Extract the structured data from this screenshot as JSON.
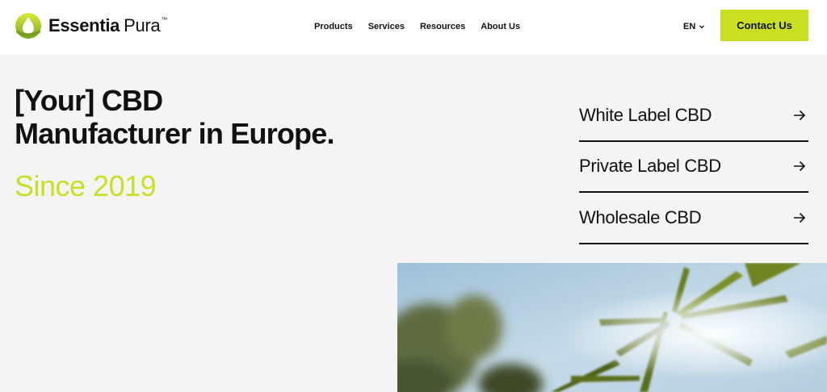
{
  "brand": {
    "name_part1": "Essentia",
    "name_part2": "Pura",
    "trademark": "™",
    "accent_color": "#c8df22"
  },
  "nav": {
    "items": [
      {
        "label": "Products"
      },
      {
        "label": "Services"
      },
      {
        "label": "Resources"
      },
      {
        "label": "About Us"
      }
    ]
  },
  "header": {
    "language": "EN",
    "contact_label": "Contact Us"
  },
  "hero": {
    "title_line1": "[Your] CBD",
    "title_line2": "Manufacturer in Europe.",
    "subtitle": "Since 2019"
  },
  "cta_links": [
    {
      "label": "White Label CBD",
      "icon": "arrow-right-icon"
    },
    {
      "label": "Private Label CBD",
      "icon": "arrow-right-icon"
    },
    {
      "label": "Wholesale CBD",
      "icon": "arrow-right-icon"
    }
  ],
  "colors": {
    "background": "#f4f4f4",
    "header_bg": "#ffffff",
    "accent": "#c8df22",
    "text": "#111111"
  }
}
